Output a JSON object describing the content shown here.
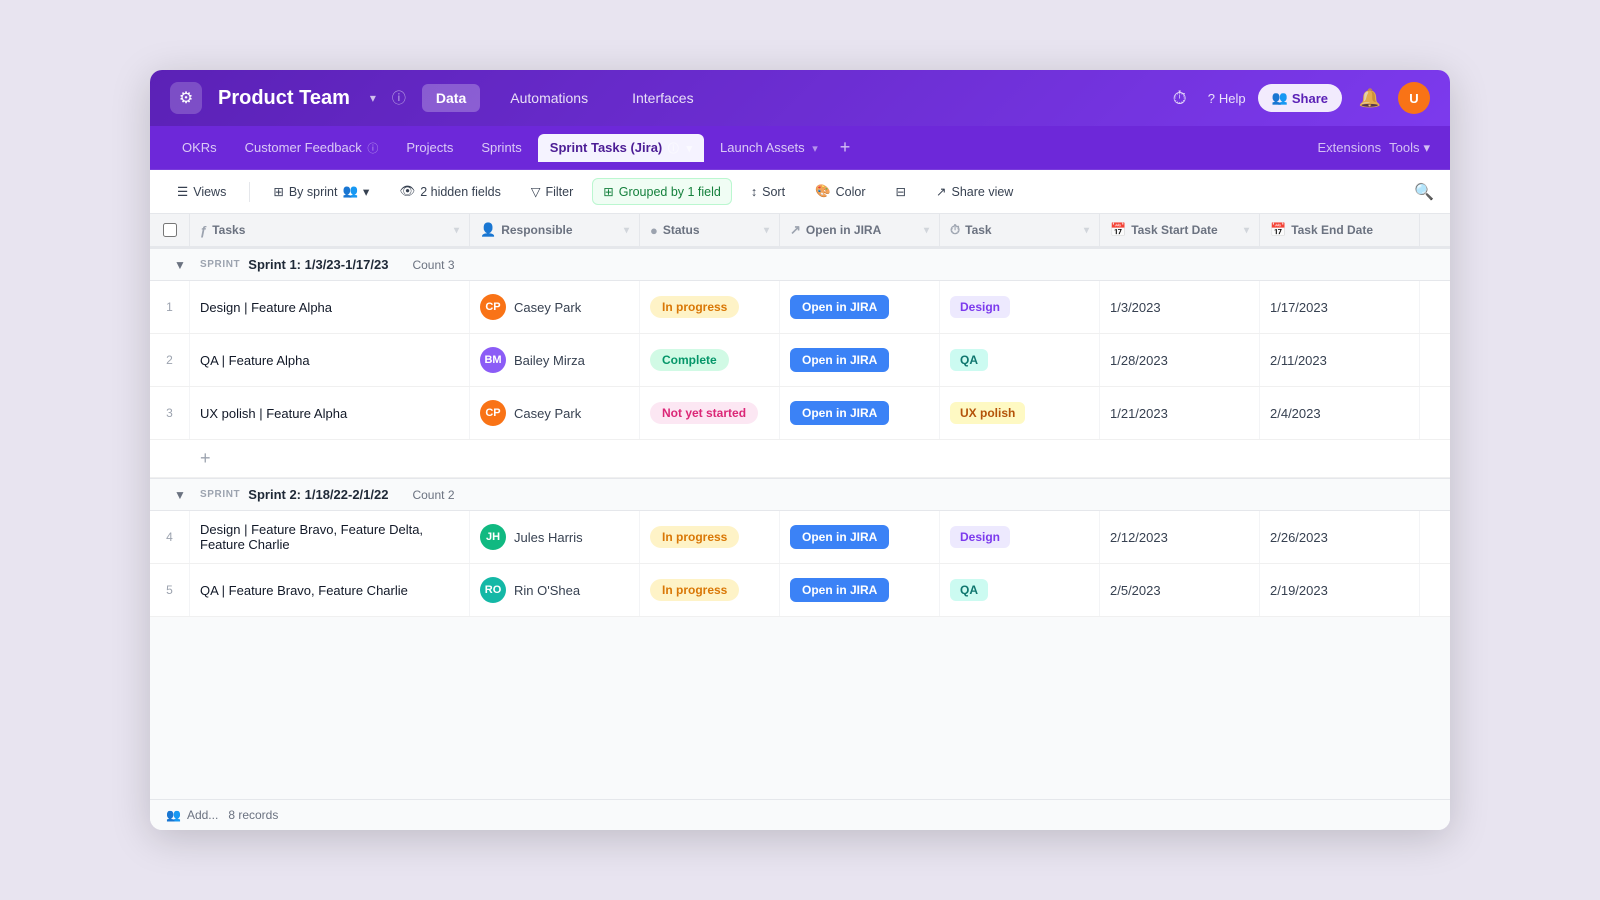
{
  "app": {
    "logo": "⚙",
    "workspace_title": "Product Team",
    "info_icon": "ⓘ",
    "nav_tabs": [
      {
        "label": "Data",
        "active": true
      },
      {
        "label": "Automations",
        "active": false
      },
      {
        "label": "Interfaces",
        "active": false
      }
    ],
    "nav_right": {
      "help_label": "Help",
      "share_label": "Share",
      "bell_icon": "🔔",
      "history_icon": "⏱"
    }
  },
  "tabs": [
    {
      "label": "OKRs",
      "active": false
    },
    {
      "label": "Customer Feedback",
      "active": false,
      "info": true
    },
    {
      "label": "Projects",
      "active": false
    },
    {
      "label": "Sprints",
      "active": false
    },
    {
      "label": "Sprint Tasks (Jira)",
      "active": true,
      "info": true
    },
    {
      "label": "Launch Assets",
      "active": false
    }
  ],
  "tabs_right": {
    "extensions_label": "Extensions",
    "tools_label": "Tools"
  },
  "toolbar": {
    "views_label": "Views",
    "by_sprint_label": "By sprint",
    "hidden_fields_label": "2 hidden fields",
    "filter_label": "Filter",
    "grouped_label": "Grouped by 1 field",
    "sort_label": "Sort",
    "color_label": "Color",
    "share_view_label": "Share view"
  },
  "columns": [
    {
      "label": "Tasks",
      "icon": "ƒ"
    },
    {
      "label": "Responsible",
      "icon": "👤"
    },
    {
      "label": "Status",
      "icon": "●"
    },
    {
      "label": "Open in JIRA",
      "icon": "↗"
    },
    {
      "label": "Task",
      "icon": "⏱"
    },
    {
      "label": "Task Start Date",
      "icon": "📅"
    },
    {
      "label": "Task End Date",
      "icon": "📅"
    }
  ],
  "sprint1": {
    "tag": "SPRINT",
    "name": "Sprint 1: 1/3/23-1/17/23",
    "count_label": "Count",
    "count": "3",
    "rows": [
      {
        "num": "1",
        "task": "Design | Feature Alpha",
        "responsible": "Casey Park",
        "av_color": "av-orange",
        "av_initials": "CP",
        "status": "In progress",
        "status_class": "status-in-progress",
        "jira_label": "Open in JIRA",
        "task_tag": "Design",
        "task_tag_class": "tag-design",
        "start_date": "1/3/2023",
        "end_date": "1/17/2023"
      },
      {
        "num": "2",
        "task": "QA | Feature Alpha",
        "responsible": "Bailey Mirza",
        "av_color": "av-purple",
        "av_initials": "BM",
        "status": "Complete",
        "status_class": "status-complete",
        "jira_label": "Open in JIRA",
        "task_tag": "QA",
        "task_tag_class": "tag-qa",
        "start_date": "1/28/2023",
        "end_date": "2/11/2023"
      },
      {
        "num": "3",
        "task": "UX polish | Feature Alpha",
        "responsible": "Casey Park",
        "av_color": "av-orange",
        "av_initials": "CP",
        "status": "Not yet started",
        "status_class": "status-not-started",
        "jira_label": "Open in JIRA",
        "task_tag": "UX polish",
        "task_tag_class": "tag-ux",
        "start_date": "1/21/2023",
        "end_date": "2/4/2023"
      }
    ]
  },
  "sprint2": {
    "tag": "SPRINT",
    "name": "Sprint 2: 1/18/22-2/1/22",
    "count_label": "Count",
    "count": "2",
    "rows": [
      {
        "num": "4",
        "task": "Design | Feature Bravo, Feature Delta, Feature Charlie",
        "responsible": "Jules Harris",
        "av_color": "av-green",
        "av_initials": "JH",
        "status": "In progress",
        "status_class": "status-in-progress",
        "jira_label": "Open in JIRA",
        "task_tag": "Design",
        "task_tag_class": "tag-design",
        "start_date": "2/12/2023",
        "end_date": "2/26/2023"
      },
      {
        "num": "5",
        "task": "QA | Feature Bravo, Feature Charlie",
        "responsible": "Rin O'Shea",
        "av_color": "av-teal",
        "av_initials": "RO",
        "status": "In progress",
        "status_class": "status-in-progress",
        "jira_label": "Open in JIRA",
        "task_tag": "QA",
        "task_tag_class": "tag-qa",
        "start_date": "2/5/2023",
        "end_date": "2/19/2023"
      }
    ]
  },
  "footer": {
    "add_label": "Add...",
    "records_count": "8 records"
  }
}
